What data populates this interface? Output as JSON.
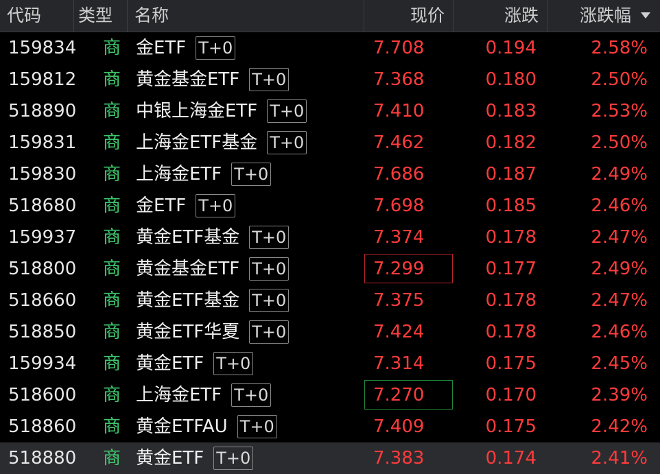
{
  "header": {
    "code": "代码",
    "type": "类型",
    "name": "名称",
    "price": "现价",
    "change": "涨跌",
    "change_pct": "涨跌幅",
    "sort_icon": "sort-desc-triangle"
  },
  "colors": {
    "up": "#ff3b3b",
    "type_tag": "#3fc76b",
    "flash_up_border": "#b8262a",
    "flash_down_border": "#1f8a3b",
    "header_bg": "#26272b",
    "selected_row_bg": "#2b2c30"
  },
  "rows": [
    {
      "code": "159834",
      "type": "商",
      "name": "金ETF",
      "badge": "T+0",
      "price": "7.708",
      "change": "0.194",
      "pct": "2.58%"
    },
    {
      "code": "159812",
      "type": "商",
      "name": "黄金基金ETF",
      "badge": "T+0",
      "price": "7.368",
      "change": "0.180",
      "pct": "2.50%"
    },
    {
      "code": "518890",
      "type": "商",
      "name": "中银上海金ETF",
      "badge": "T+0",
      "price": "7.410",
      "change": "0.183",
      "pct": "2.53%"
    },
    {
      "code": "159831",
      "type": "商",
      "name": "上海金ETF基金",
      "badge": "T+0",
      "price": "7.462",
      "change": "0.182",
      "pct": "2.50%"
    },
    {
      "code": "159830",
      "type": "商",
      "name": "上海金ETF",
      "badge": "T+0",
      "price": "7.686",
      "change": "0.187",
      "pct": "2.49%"
    },
    {
      "code": "518680",
      "type": "商",
      "name": "金ETF",
      "badge": "T+0",
      "price": "7.698",
      "change": "0.185",
      "pct": "2.46%"
    },
    {
      "code": "159937",
      "type": "商",
      "name": "黄金ETF基金",
      "badge": "T+0",
      "price": "7.374",
      "change": "0.178",
      "pct": "2.47%"
    },
    {
      "code": "518800",
      "type": "商",
      "name": "黄金基金ETF",
      "badge": "T+0",
      "price": "7.299",
      "change": "0.177",
      "pct": "2.49%",
      "flash": "up"
    },
    {
      "code": "518660",
      "type": "商",
      "name": "黄金ETF基金",
      "badge": "T+0",
      "price": "7.375",
      "change": "0.178",
      "pct": "2.47%"
    },
    {
      "code": "518850",
      "type": "商",
      "name": "黄金ETF华夏",
      "badge": "T+0",
      "price": "7.424",
      "change": "0.178",
      "pct": "2.46%"
    },
    {
      "code": "159934",
      "type": "商",
      "name": "黄金ETF",
      "badge": "T+0",
      "price": "7.314",
      "change": "0.175",
      "pct": "2.45%"
    },
    {
      "code": "518600",
      "type": "商",
      "name": "上海金ETF",
      "badge": "T+0",
      "price": "7.270",
      "change": "0.170",
      "pct": "2.39%",
      "flash": "down"
    },
    {
      "code": "518860",
      "type": "商",
      "name": "黄金ETFAU",
      "badge": "T+0",
      "price": "7.409",
      "change": "0.175",
      "pct": "2.42%"
    },
    {
      "code": "518880",
      "type": "商",
      "name": "黄金ETF",
      "badge": "T+0",
      "price": "7.383",
      "change": "0.174",
      "pct": "2.41%",
      "selected": true
    }
  ]
}
